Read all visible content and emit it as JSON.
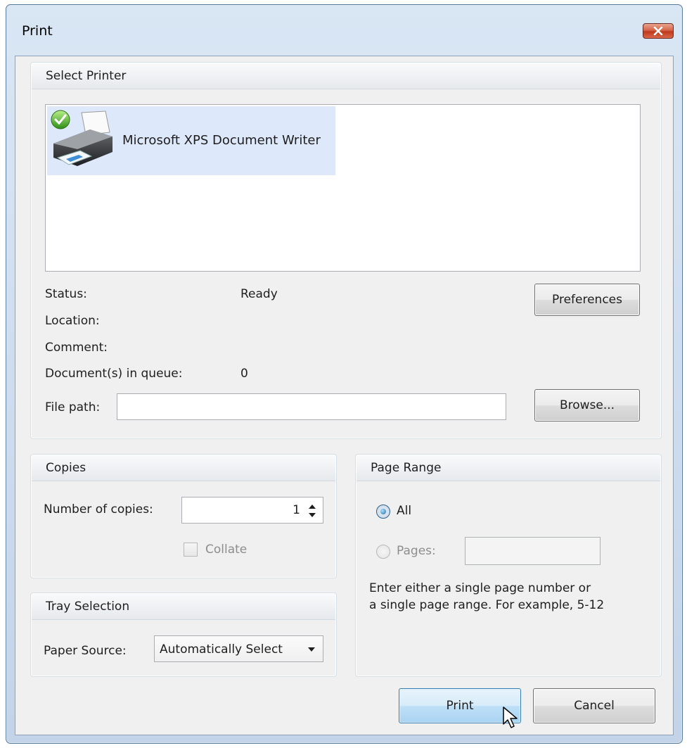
{
  "window": {
    "title": "Print"
  },
  "select_printer": {
    "header": "Select Printer",
    "printers": [
      {
        "name": "Microsoft XPS Document Writer",
        "selected": true,
        "default": true
      }
    ],
    "status_label": "Status:",
    "status_value": "Ready",
    "location_label": "Location:",
    "location_value": "",
    "comment_label": "Comment:",
    "comment_value": "",
    "queue_label": "Document(s) in queue:",
    "queue_value": "0",
    "file_path_label": "File path:",
    "file_path_value": "",
    "preferences_label": "Preferences",
    "browse_label": "Browse..."
  },
  "copies": {
    "header": "Copies",
    "number_label": "Number of copies:",
    "number_value": "1",
    "collate_label": "Collate",
    "collate_checked": false,
    "collate_enabled": false
  },
  "tray": {
    "header": "Tray Selection",
    "paper_source_label": "Paper Source:",
    "paper_source_value": "Automatically Select"
  },
  "page_range": {
    "header": "Page Range",
    "all_label": "All",
    "all_selected": true,
    "pages_label": "Pages:",
    "pages_value": "",
    "help_line1": "Enter either a single page number or",
    "help_line2": "a single page range. For example, 5-12"
  },
  "buttons": {
    "print": "Print",
    "cancel": "Cancel"
  },
  "colors": {
    "selection": "#dde8fb",
    "dialog_bg": "#f0f0f0",
    "title_gradient": "#c3d4e8",
    "close_red": "#c0391b"
  }
}
